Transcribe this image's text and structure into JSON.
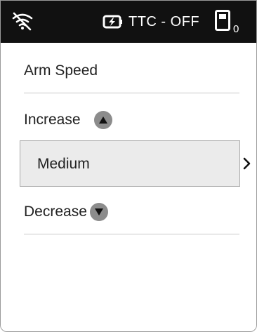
{
  "status_bar": {
    "wifi_icon": "wifi-off-icon",
    "battery_icon": "battery-charging-icon",
    "ttc_status": "TTC - OFF",
    "device_icon": "handheld-device-icon",
    "device_count": "0"
  },
  "screen": {
    "title": "Arm Speed",
    "increase_label": "Increase",
    "increase_icon": "triangle-up-icon",
    "current_value": "Medium",
    "next_icon": "chevron-right-icon",
    "decrease_label": "Decrease",
    "decrease_icon": "triangle-down-icon"
  },
  "colors": {
    "status_bar_bg": "#111111",
    "value_box_bg": "#ebebeb",
    "arrow_button_bg": "#8c8c8c"
  }
}
